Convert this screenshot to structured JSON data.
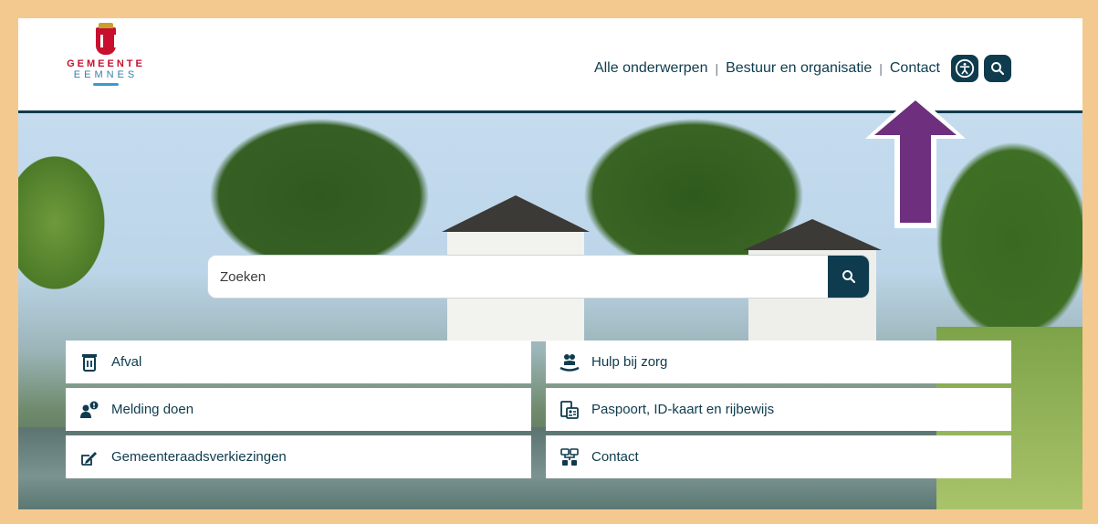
{
  "header": {
    "logo": {
      "line1": "GEMEENTE",
      "line2": "EEMNES"
    },
    "nav": [
      {
        "label": "Alle onderwerpen"
      },
      {
        "label": "Bestuur en organisatie"
      },
      {
        "label": "Contact"
      }
    ],
    "icons": {
      "accessibility": "accessibility-icon",
      "search": "search-icon"
    }
  },
  "search": {
    "placeholder": "Zoeken"
  },
  "tiles": [
    {
      "label": "Afval",
      "icon": "waste-bin-icon"
    },
    {
      "label": "Hulp bij zorg",
      "icon": "care-icon"
    },
    {
      "label": "Melding doen",
      "icon": "report-user-icon"
    },
    {
      "label": "Paspoort, ID-kaart en rijbewijs",
      "icon": "id-card-icon"
    },
    {
      "label": "Gemeenteraadsverkiezingen",
      "icon": "pen-vote-icon"
    },
    {
      "label": "Contact",
      "icon": "contact-network-icon"
    }
  ],
  "colors": {
    "brand": "#0e3b4e",
    "accent": "#c8102e",
    "frame": "#f4c98f",
    "annotation_arrow": "#6e2f7e"
  }
}
